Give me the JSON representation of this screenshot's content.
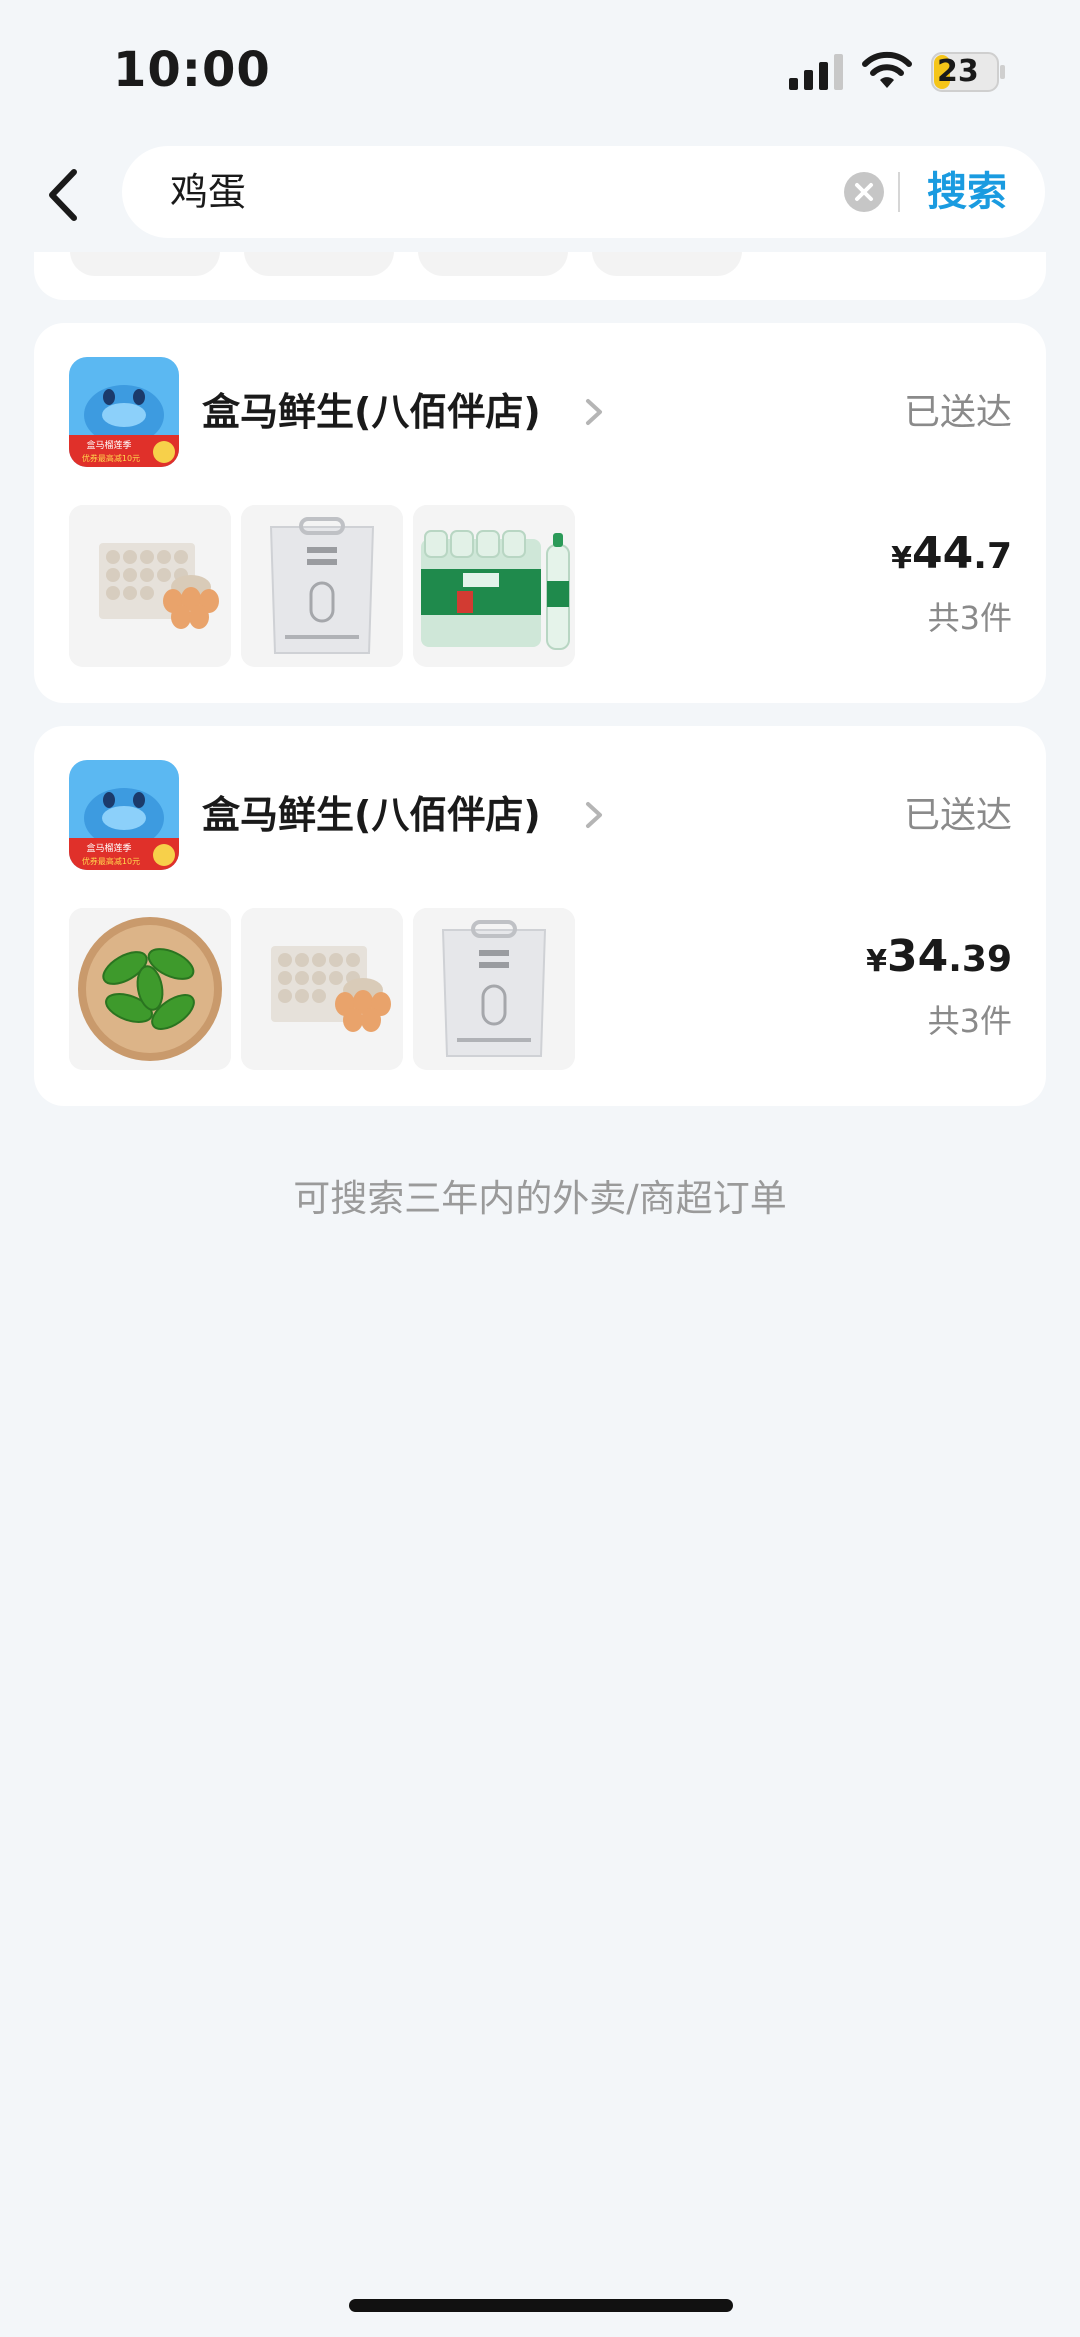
{
  "status_bar": {
    "time": "10:00",
    "battery": "23"
  },
  "search": {
    "query": "鸡蛋",
    "button_label": "搜索"
  },
  "orders": [
    {
      "store_name": "盒马鲜生(八佰伴店)",
      "status": "已送达",
      "price_currency": "¥",
      "price_integer": "44",
      "price_decimal": ".7",
      "item_count": "共3件",
      "logo_banner_1": "盒马榴莲季",
      "logo_banner_2": "优券最高减10元",
      "items": [
        "egg-tray",
        "rice-bag",
        "water-bottles"
      ]
    },
    {
      "store_name": "盒马鲜生(八佰伴店)",
      "status": "已送达",
      "price_currency": "¥",
      "price_integer": "34",
      "price_decimal": ".39",
      "item_count": "共3件",
      "logo_banner_1": "盒马榴莲季",
      "logo_banner_2": "优券最高减10元",
      "items": [
        "green-peppers",
        "egg-tray",
        "rice-bag"
      ]
    }
  ],
  "footer_hint": "可搜索三年内的外卖/商超订单"
}
